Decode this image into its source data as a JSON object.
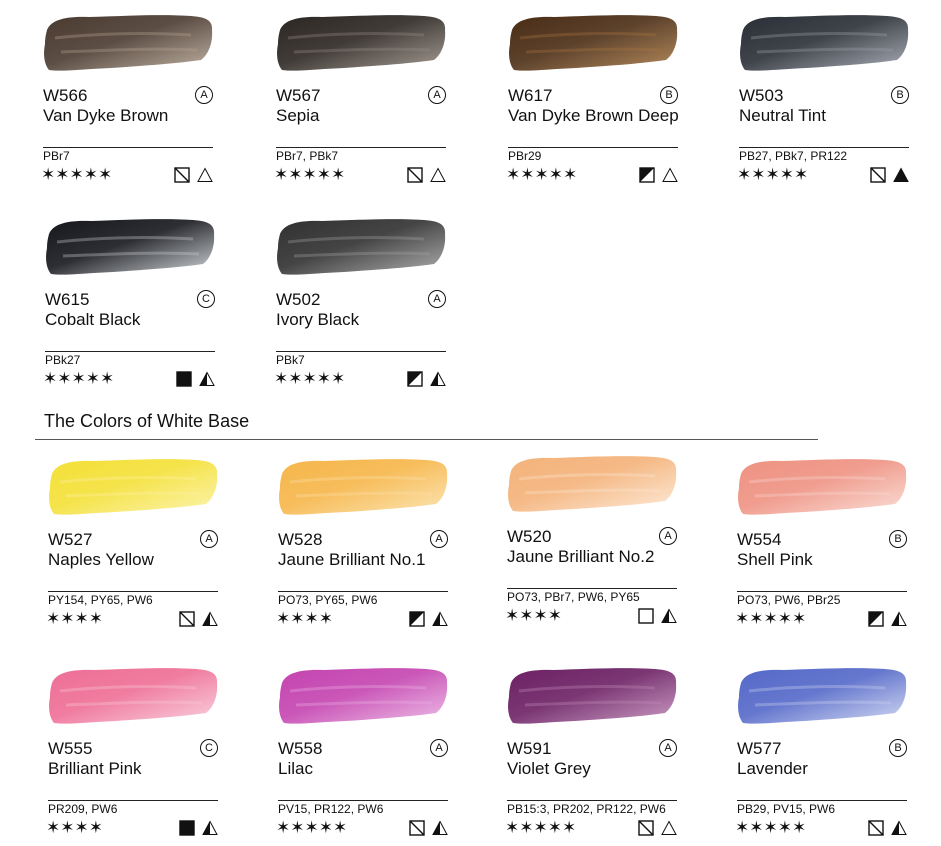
{
  "section": {
    "title": "The Colors of White Base"
  },
  "colors": {
    "c0": {
      "code": "W566",
      "name": "Van Dyke Brown",
      "grade": "A",
      "pigments": "PBr7",
      "stars": "✶✶✶✶✶",
      "transparency": "semi-transparent",
      "staining": "low",
      "color_main": "#4a3a30",
      "color_light": "#b4a292"
    },
    "c1": {
      "code": "W567",
      "name": "Sepia",
      "grade": "A",
      "pigments": "PBr7, PBk7",
      "stars": "✶✶✶✶✶",
      "transparency": "semi-transparent",
      "staining": "low",
      "color_main": "#2c2622",
      "color_light": "#948a80"
    },
    "c2": {
      "code": "W617",
      "name": "Van Dyke Brown Deep",
      "grade": "B",
      "pigments": "PBr29",
      "stars": "✶✶✶✶✶",
      "transparency": "semi-opaque",
      "staining": "low",
      "color_main": "#4a2c14",
      "color_light": "#a5743e"
    },
    "c3": {
      "code": "W503",
      "name": "Neutral Tint",
      "grade": "B",
      "pigments": "PB27, PBk7, PR122",
      "stars": "✶✶✶✶✶",
      "transparency": "semi-transparent",
      "staining": "high",
      "color_main": "#2a2e36",
      "color_light": "#9aa0aa"
    },
    "c4": {
      "code": "W615",
      "name": "Cobalt Black",
      "grade": "C",
      "pigments": "PBk27",
      "stars": "✶✶✶✶✶",
      "transparency": "opaque",
      "staining": "medium",
      "color_main": "#15171c",
      "color_light": "#c8ccd0"
    },
    "c5": {
      "code": "W502",
      "name": "Ivory Black",
      "grade": "A",
      "pigments": "PBk7",
      "stars": "✶✶✶✶✶",
      "transparency": "semi-opaque",
      "staining": "medium",
      "color_main": "#303030",
      "color_light": "#a0a0a0"
    },
    "c6": {
      "code": "W527",
      "name": "Naples Yellow",
      "grade": "A",
      "pigments": "PY154, PY65, PW6",
      "stars": "✶✶✶✶",
      "transparency": "semi-transparent",
      "staining": "medium",
      "color_main": "#f4e038",
      "color_light": "#fbf2a0"
    },
    "c7": {
      "code": "W528",
      "name": "Jaune Brilliant No.1",
      "grade": "A",
      "pigments": "PO73, PY65, PW6",
      "stars": "✶✶✶✶",
      "transparency": "semi-opaque",
      "staining": "medium",
      "color_main": "#f6b64a",
      "color_light": "#fbe0a6"
    },
    "c8": {
      "code": "W520",
      "name": "Jaune Brilliant No.2",
      "grade": "A",
      "pigments": "PO73, PBr7, PW6, PY65",
      "stars": "✶✶✶✶",
      "transparency": "transparent",
      "staining": "medium",
      "color_main": "#f4b27a",
      "color_light": "#fde6cf"
    },
    "c9": {
      "code": "W554",
      "name": "Shell Pink",
      "grade": "B",
      "pigments": "PO73, PW6, PBr25",
      "stars": "✶✶✶✶✶",
      "transparency": "semi-opaque",
      "staining": "medium",
      "color_main": "#ee9282",
      "color_light": "#fad8d0"
    },
    "c10": {
      "code": "W555",
      "name": "Brilliant Pink",
      "grade": "C",
      "pigments": "PR209, PW6",
      "stars": "✶✶✶✶",
      "transparency": "opaque",
      "staining": "medium",
      "color_main": "#ee6e96",
      "color_light": "#f8c8d8"
    },
    "c11": {
      "code": "W558",
      "name": "Lilac",
      "grade": "A",
      "pigments": "PV15, PR122, PW6",
      "stars": "✶✶✶✶✶",
      "transparency": "semi-transparent",
      "staining": "medium",
      "color_main": "#c444b0",
      "color_light": "#eab0e2"
    },
    "c12": {
      "code": "W591",
      "name": "Violet Grey",
      "grade": "A",
      "pigments": "PB15:3, PR202, PR122, PW6",
      "stars": "✶✶✶✶✶",
      "transparency": "semi-transparent",
      "staining": "low",
      "color_main": "#6c2064",
      "color_light": "#c08ab8"
    },
    "c13": {
      "code": "W577",
      "name": "Lavender",
      "grade": "B",
      "pigments": "PB29, PV15, PW6",
      "stars": "✶✶✶✶✶",
      "transparency": "semi-transparent",
      "staining": "medium",
      "color_main": "#5468c8",
      "color_light": "#cad2f0"
    }
  }
}
